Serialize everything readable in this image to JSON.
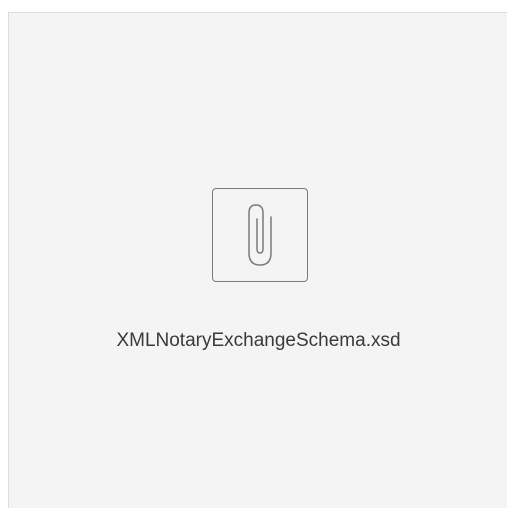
{
  "attachment": {
    "file_name": "XMLNotaryExchangeSchema.xsd",
    "icon": "paperclip-icon",
    "colors": {
      "tile_background": "#f4f4f4",
      "icon_stroke": "#7a7a7a",
      "text": "#3a3a3a"
    }
  }
}
